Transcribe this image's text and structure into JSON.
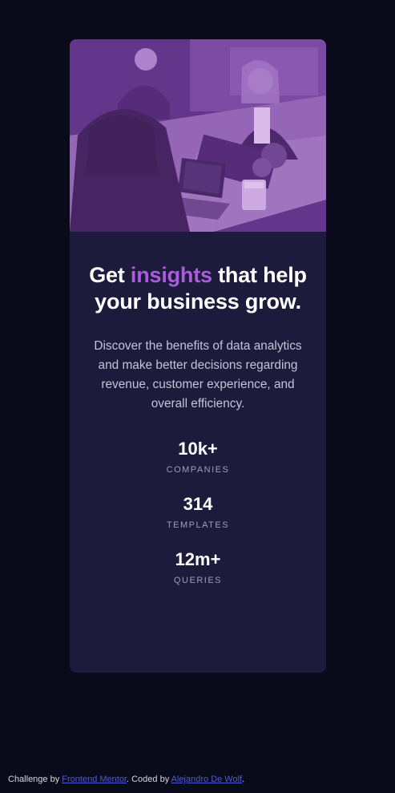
{
  "card": {
    "title_prefix": "Get ",
    "title_accent": "insights",
    "title_suffix": " that help your business grow.",
    "description": "Discover the benefits of data analytics and make better decisions regarding revenue, customer experience, and overall efficiency.",
    "stats": [
      {
        "value": "10k+",
        "label": "COMPANIES"
      },
      {
        "value": "314",
        "label": "TEMPLATES"
      },
      {
        "value": "12m+",
        "label": "QUERIES"
      }
    ]
  },
  "attribution": {
    "prefix": "Challenge by ",
    "link1": "Frontend Mentor",
    "middle": ". Coded by ",
    "link2": "Alejandro De Wolf",
    "suffix": "."
  },
  "colors": {
    "page_bg": "#090b1a",
    "card_bg": "#1c1b3b",
    "accent": "#aa5cdb",
    "image_overlay": "#4b2a72"
  }
}
